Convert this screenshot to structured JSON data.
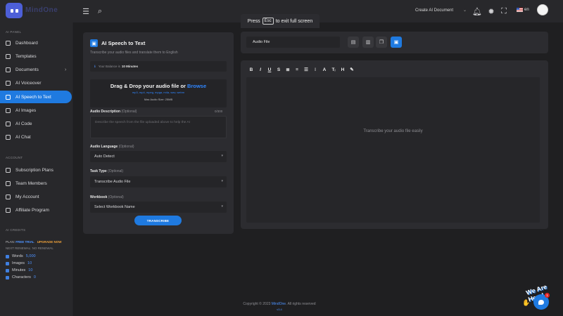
{
  "header": {
    "logo_text": "MindOne",
    "fullscreen_press": "Press",
    "fullscreen_key": "Esc",
    "fullscreen_suffix": "to exit full screen",
    "create_doc": "Create AI Document",
    "language": "en"
  },
  "sidebar": {
    "panel_label": "AI PANEL",
    "items": [
      {
        "label": "Dashboard"
      },
      {
        "label": "Templates"
      },
      {
        "label": "Documents"
      },
      {
        "label": "AI Voiceover"
      },
      {
        "label": "AI Speech to Text"
      },
      {
        "label": "AI Images"
      },
      {
        "label": "AI Code"
      },
      {
        "label": "AI Chat"
      }
    ],
    "account_label": "ACCOUNT",
    "account_items": [
      {
        "label": "Subscription Plans"
      },
      {
        "label": "Team Members"
      },
      {
        "label": "My Account"
      },
      {
        "label": "Affiliate Program"
      }
    ],
    "credits_label": "AI CREDITS",
    "plan_prefix": "PLAN:",
    "plan_name": "FREE TRIAL",
    "upgrade": "UPGRADE NOW",
    "renewal": "NEXT RENEWAL: NO RENEWAL",
    "credits": [
      {
        "label": "Words",
        "value": "5,000"
      },
      {
        "label": "Images",
        "value": "10"
      },
      {
        "label": "Minutes",
        "value": "10"
      },
      {
        "label": "Characters",
        "value": "0"
      }
    ]
  },
  "form": {
    "title": "AI Speech to Text",
    "subtitle": "Transcribe your audio files and translate them to English",
    "balance_prefix": "Your Balance is",
    "balance_value": "10 Minutes",
    "drop_title": "Drag & Drop your audio file or",
    "drop_browse": "Browse",
    "drop_types": "mp3, mp4, mpeg, mpga, m4a, wav, webm",
    "drop_max": "Max Audio Size: 25MB",
    "desc_label": "Audio Description",
    "optional": "(Optional)",
    "desc_counter": "0/300",
    "desc_placeholder": "Describe the speech from the file uploaded above to help the AI",
    "lang_label": "Audio Language",
    "lang_value": "Auto Detect",
    "task_label": "Task Type",
    "task_value": "Transcribe Audio File",
    "workbook_label": "Workbook",
    "workbook_value": "Select Workbook Name",
    "transcribe_button": "TRANSCRIBE"
  },
  "editor": {
    "file_name": "Audio File",
    "toolbar": [
      "B",
      "I",
      "U",
      "S",
      "≣",
      "≡",
      "☰",
      "⁝",
      "A",
      "Tᵢ",
      "H",
      "✎"
    ],
    "placeholder": "Transcribe your audio file easily"
  },
  "footer": {
    "copyright_prefix": "Copyright © 2023",
    "brand": "MindOne",
    "copyright_suffix": ". All rights reserved",
    "version": "v3.4"
  },
  "chat_widget": {
    "label": "We Are Here!",
    "badge": "1"
  }
}
